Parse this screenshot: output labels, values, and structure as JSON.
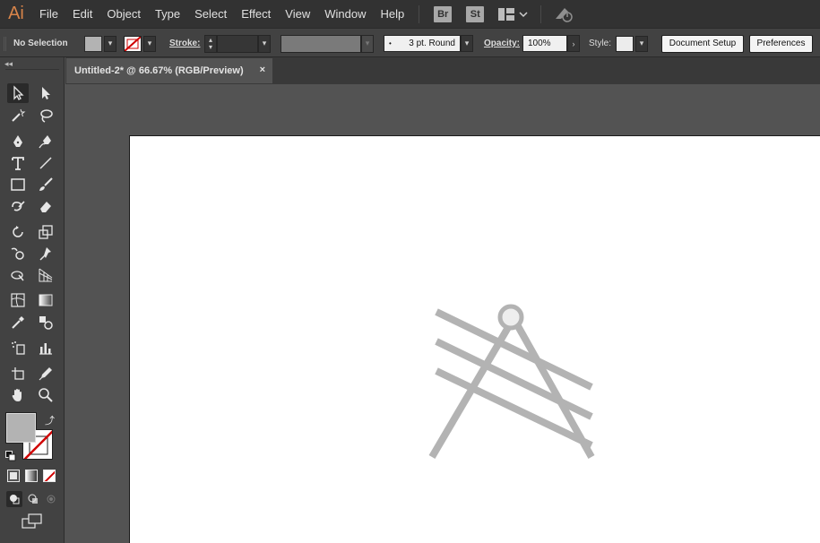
{
  "app": {
    "logo": "Ai",
    "logo_color": "#d7844a"
  },
  "menu": [
    "File",
    "Edit",
    "Object",
    "Type",
    "Select",
    "Effect",
    "View",
    "Window",
    "Help"
  ],
  "app_buttons": {
    "bridge": "Br",
    "stock": "St"
  },
  "control_bar": {
    "selection_state": "No Selection",
    "stroke_label": "Stroke:",
    "brush_label": "3 pt. Round",
    "opacity_label": "Opacity:",
    "opacity_value": "100%",
    "style_label": "Style:",
    "document_setup": "Document Setup",
    "preferences": "Preferences"
  },
  "document_tab": {
    "title": "Untitled-2* @ 66.67% (RGB/Preview)",
    "close": "×"
  },
  "colors": {
    "ui_dark": "#323232",
    "panel": "#424242",
    "pasteboard": "#535353",
    "artboard": "#ffffff",
    "artwork_stroke": "#b3b3b3",
    "artwork_circle_fill": "#eeeeee"
  },
  "tools": [
    "selection-tool-icon",
    "direct-selection-tool-icon",
    "magic-wand-tool-icon",
    "lasso-tool-icon",
    "pen-tool-icon",
    "curvature-tool-icon",
    "type-tool-icon",
    "line-segment-tool-icon",
    "rectangle-tool-icon",
    "paintbrush-tool-icon",
    "shaper-tool-icon",
    "eraser-tool-icon",
    "rotate-tool-icon",
    "scale-tool-icon",
    "warp-tool-icon",
    "free-transform-tool-icon",
    "shape-builder-tool-icon",
    "perspective-grid-tool-icon",
    "mesh-tool-icon",
    "gradient-tool-icon",
    "eyedropper-tool-icon",
    "blend-tool-icon",
    "symbol-sprayer-tool-icon",
    "column-graph-tool-icon",
    "artboard-tool-icon",
    "slice-tool-icon",
    "hand-tool-icon",
    "zoom-tool-icon"
  ]
}
